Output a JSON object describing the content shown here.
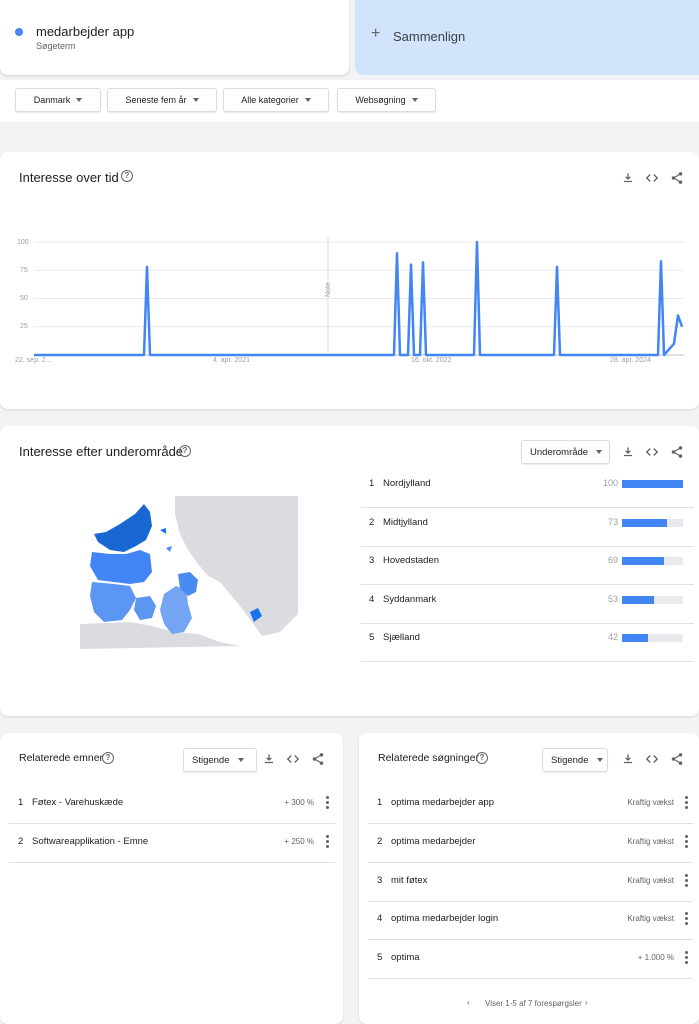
{
  "term": {
    "name": "medarbejder app",
    "type": "Søgeterm",
    "color": "#4285f4"
  },
  "compare": {
    "plus": "+",
    "label": "Sammenlign"
  },
  "filters": [
    "Danmark",
    "Seneste fem år",
    "Alle kategorier",
    "Websøgning"
  ],
  "interest_over_time": {
    "title": "Interesse over tid",
    "note_label": "Note",
    "help_icon": "help-circle-icon",
    "tools": [
      "download-icon",
      "embed-code-icon",
      "share-icon"
    ]
  },
  "chart_data": {
    "type": "line",
    "x_tick_labels": [
      "22. sep. 2...",
      "4. apr. 2021",
      "16. okt. 2022",
      "28. apr. 2024"
    ],
    "y_tick_labels": [
      "100",
      "75",
      "50",
      "25"
    ],
    "ylim": [
      0,
      100
    ],
    "grid": true,
    "series": [
      {
        "color": "#4285f4",
        "points": [
          [
            0,
            0
          ],
          [
            110,
            0
          ],
          [
            113,
            78
          ],
          [
            116,
            0
          ],
          [
            360,
            0
          ],
          [
            363,
            90
          ],
          [
            366,
            0
          ],
          [
            374,
            0
          ],
          [
            377,
            80
          ],
          [
            380,
            0
          ],
          [
            386,
            0
          ],
          [
            389,
            82
          ],
          [
            392,
            0
          ],
          [
            440,
            0
          ],
          [
            443,
            100
          ],
          [
            446,
            0
          ],
          [
            520,
            0
          ],
          [
            523,
            78
          ],
          [
            526,
            0
          ],
          [
            624,
            0
          ],
          [
            627,
            83
          ],
          [
            630,
            0
          ],
          [
            640,
            10
          ],
          [
            644,
            35
          ],
          [
            648,
            25
          ]
        ]
      }
    ]
  },
  "subregion": {
    "title": "Interesse efter underområde",
    "dropdown": "Underområde",
    "rows": [
      {
        "rank": "1",
        "name": "Nordjylland",
        "value": "100",
        "pct": 100
      },
      {
        "rank": "2",
        "name": "Midtjylland",
        "value": "73",
        "pct": 73
      },
      {
        "rank": "3",
        "name": "Hovedstaden",
        "value": "69",
        "pct": 69
      },
      {
        "rank": "4",
        "name": "Syddanmark",
        "value": "53",
        "pct": 53
      },
      {
        "rank": "5",
        "name": "Sjælland",
        "value": "42",
        "pct": 42
      }
    ]
  },
  "related_topics": {
    "title": "Relaterede emner",
    "dropdown": "Stigende",
    "rows": [
      {
        "rank": "1",
        "name": "Føtex - Varehuskæde",
        "value": "+ 300 %"
      },
      {
        "rank": "2",
        "name": "Softwareapplikation - Emne",
        "value": "+ 250 %"
      }
    ]
  },
  "related_queries": {
    "title": "Relaterede søgninger",
    "dropdown": "Stigende",
    "rows": [
      {
        "rank": "1",
        "name": "optima medarbejder app",
        "value": "Kraftig vækst"
      },
      {
        "rank": "2",
        "name": "optima medarbejder",
        "value": "Kraftig vækst"
      },
      {
        "rank": "3",
        "name": "mit føtex",
        "value": "Kraftig vækst"
      },
      {
        "rank": "4",
        "name": "optima medarbejder login",
        "value": "Kraftig vækst"
      },
      {
        "rank": "5",
        "name": "optima",
        "value": "+ 1.000 %"
      }
    ],
    "pager": "Viser 1-5 af 7 forespørgsler"
  }
}
